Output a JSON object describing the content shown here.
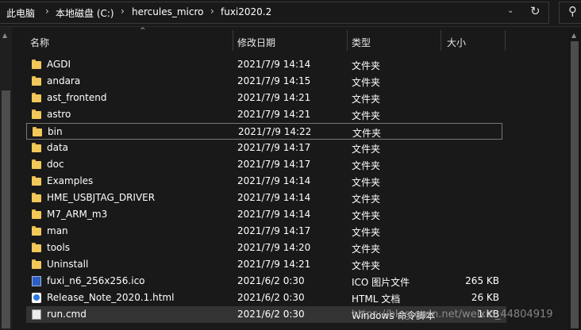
{
  "breadcrumbs": [
    "此电脑",
    "本地磁盘 (C:)",
    "hercules_micro",
    "fuxi2020.2"
  ],
  "columns": {
    "name": "名称",
    "modified": "修改日期",
    "type": "类型",
    "size": "大小"
  },
  "files": [
    {
      "name": "AGDI",
      "date": "2021/7/9 14:14",
      "type": "文件夹",
      "size": "",
      "icon": "folder-icon"
    },
    {
      "name": "andara",
      "date": "2021/7/9 14:15",
      "type": "文件夹",
      "size": "",
      "icon": "folder-icon"
    },
    {
      "name": "ast_frontend",
      "date": "2021/7/9 14:21",
      "type": "文件夹",
      "size": "",
      "icon": "folder-icon"
    },
    {
      "name": "astro",
      "date": "2021/7/9 14:21",
      "type": "文件夹",
      "size": "",
      "icon": "folder-icon"
    },
    {
      "name": "bin",
      "date": "2021/7/9 14:22",
      "type": "文件夹",
      "size": "",
      "icon": "folder-icon",
      "selected": true
    },
    {
      "name": "data",
      "date": "2021/7/9 14:17",
      "type": "文件夹",
      "size": "",
      "icon": "folder-icon"
    },
    {
      "name": "doc",
      "date": "2021/7/9 14:17",
      "type": "文件夹",
      "size": "",
      "icon": "folder-icon"
    },
    {
      "name": "Examples",
      "date": "2021/7/9 14:14",
      "type": "文件夹",
      "size": "",
      "icon": "folder-icon"
    },
    {
      "name": "HME_USBJTAG_DRIVER",
      "date": "2021/7/9 14:14",
      "type": "文件夹",
      "size": "",
      "icon": "folder-icon"
    },
    {
      "name": "M7_ARM_m3",
      "date": "2021/7/9 14:14",
      "type": "文件夹",
      "size": "",
      "icon": "folder-icon"
    },
    {
      "name": "man",
      "date": "2021/7/9 14:17",
      "type": "文件夹",
      "size": "",
      "icon": "folder-icon"
    },
    {
      "name": "tools",
      "date": "2021/7/9 14:20",
      "type": "文件夹",
      "size": "",
      "icon": "folder-icon"
    },
    {
      "name": "Uninstall",
      "date": "2021/7/9 14:21",
      "type": "文件夹",
      "size": "",
      "icon": "folder-icon"
    },
    {
      "name": "fuxi_n6_256x256.ico",
      "date": "2021/6/2 0:30",
      "type": "ICO 图片文件",
      "size": "265 KB",
      "icon": "ico-file-icon"
    },
    {
      "name": "Release_Note_2020.1.html",
      "date": "2021/6/2 0:30",
      "type": "HTML 文档",
      "size": "26 KB",
      "icon": "html-file-icon"
    },
    {
      "name": "run.cmd",
      "date": "2021/6/2 0:30",
      "type": "Windows 命令脚本",
      "size": "1 KB",
      "icon": "cmd-file-icon",
      "highlighted": true
    }
  ],
  "watermark": "https://blog.csdn.net/weixin_44804919"
}
